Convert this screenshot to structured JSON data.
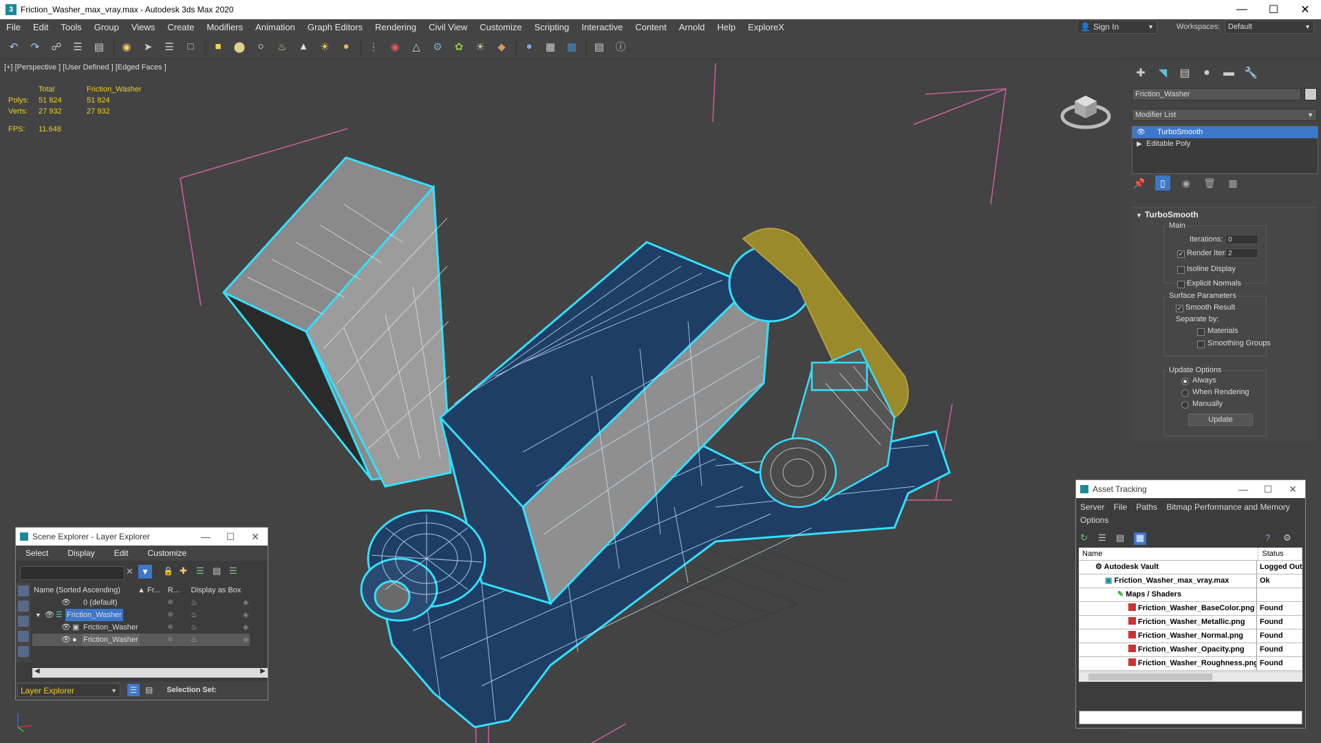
{
  "window": {
    "title": "Friction_Washer_max_vray.max - Autodesk 3ds Max 2020"
  },
  "menu": [
    "File",
    "Edit",
    "Tools",
    "Group",
    "Views",
    "Create",
    "Modifiers",
    "Animation",
    "Graph Editors",
    "Rendering",
    "Civil View",
    "Customize",
    "Scripting",
    "Interactive",
    "Content",
    "Arnold",
    "Help",
    "ExploreX"
  ],
  "account": {
    "sign_in": "Sign In",
    "workspaces_label": "Workspaces:",
    "workspace": "Default"
  },
  "viewport": {
    "label": "[+] [Perspective ] [User Defined ] [Edged Faces ]",
    "stats": {
      "col_total": "Total",
      "col_object": "Friction_Washer",
      "polys_label": "Polys:",
      "polys_total": "51 824",
      "polys_obj": "51 824",
      "verts_label": "Verts:",
      "verts_total": "27 932",
      "verts_obj": "27 932",
      "fps_label": "FPS:",
      "fps": "11.648"
    }
  },
  "command_panel": {
    "object_name": "Friction_Washer",
    "modifier_list": "Modifier List",
    "stack": [
      "TurboSmooth",
      "Editable Poly"
    ],
    "turbosmooth": {
      "title": "TurboSmooth",
      "main": "Main",
      "iterations_label": "Iterations:",
      "iterations": "0",
      "render_iters_label": "Render Iters:",
      "render_iters": "2",
      "isoline": "Isoline Display",
      "explicit_normals": "Explicit Normals",
      "surface_params": "Surface Parameters",
      "smooth_result": "Smooth Result",
      "separate_by": "Separate by:",
      "materials": "Materials",
      "smoothing_groups": "Smoothing Groups",
      "update_options": "Update Options",
      "always": "Always",
      "when_rendering": "When Rendering",
      "manually": "Manually",
      "update_btn": "Update"
    }
  },
  "scene_explorer": {
    "title": "Scene Explorer - Layer Explorer",
    "menu": [
      "Select",
      "Display",
      "Edit",
      "Customize"
    ],
    "col_name": "Name (Sorted Ascending)",
    "col_fr": "▲ Fr...",
    "col_r": "R...",
    "col_box": "Display as Box",
    "rows": [
      "0 (default)",
      "Friction_Washer",
      "Friction_Washer",
      "Friction_Washer"
    ],
    "layer_explorer": "Layer Explorer",
    "selection_set": "Selection Set:"
  },
  "asset_tracking": {
    "title": "Asset Tracking",
    "menu_line1": "Server    File    Paths    Bitmap Performance and Memory",
    "menu_line2": "Options",
    "col_name": "Name",
    "col_status": "Status",
    "rows": [
      {
        "name": "Autodesk Vault",
        "status": "Logged Out"
      },
      {
        "name": "Friction_Washer_max_vray.max",
        "status": "Ok"
      },
      {
        "name": "Maps / Shaders",
        "status": ""
      },
      {
        "name": "Friction_Washer_BaseColor.png",
        "status": "Found"
      },
      {
        "name": "Friction_Washer_Metallic.png",
        "status": "Found"
      },
      {
        "name": "Friction_Washer_Normal.png",
        "status": "Found"
      },
      {
        "name": "Friction_Washer_Opacity.png",
        "status": "Found"
      },
      {
        "name": "Friction_Washer_Roughness.png",
        "status": "Found"
      }
    ]
  }
}
